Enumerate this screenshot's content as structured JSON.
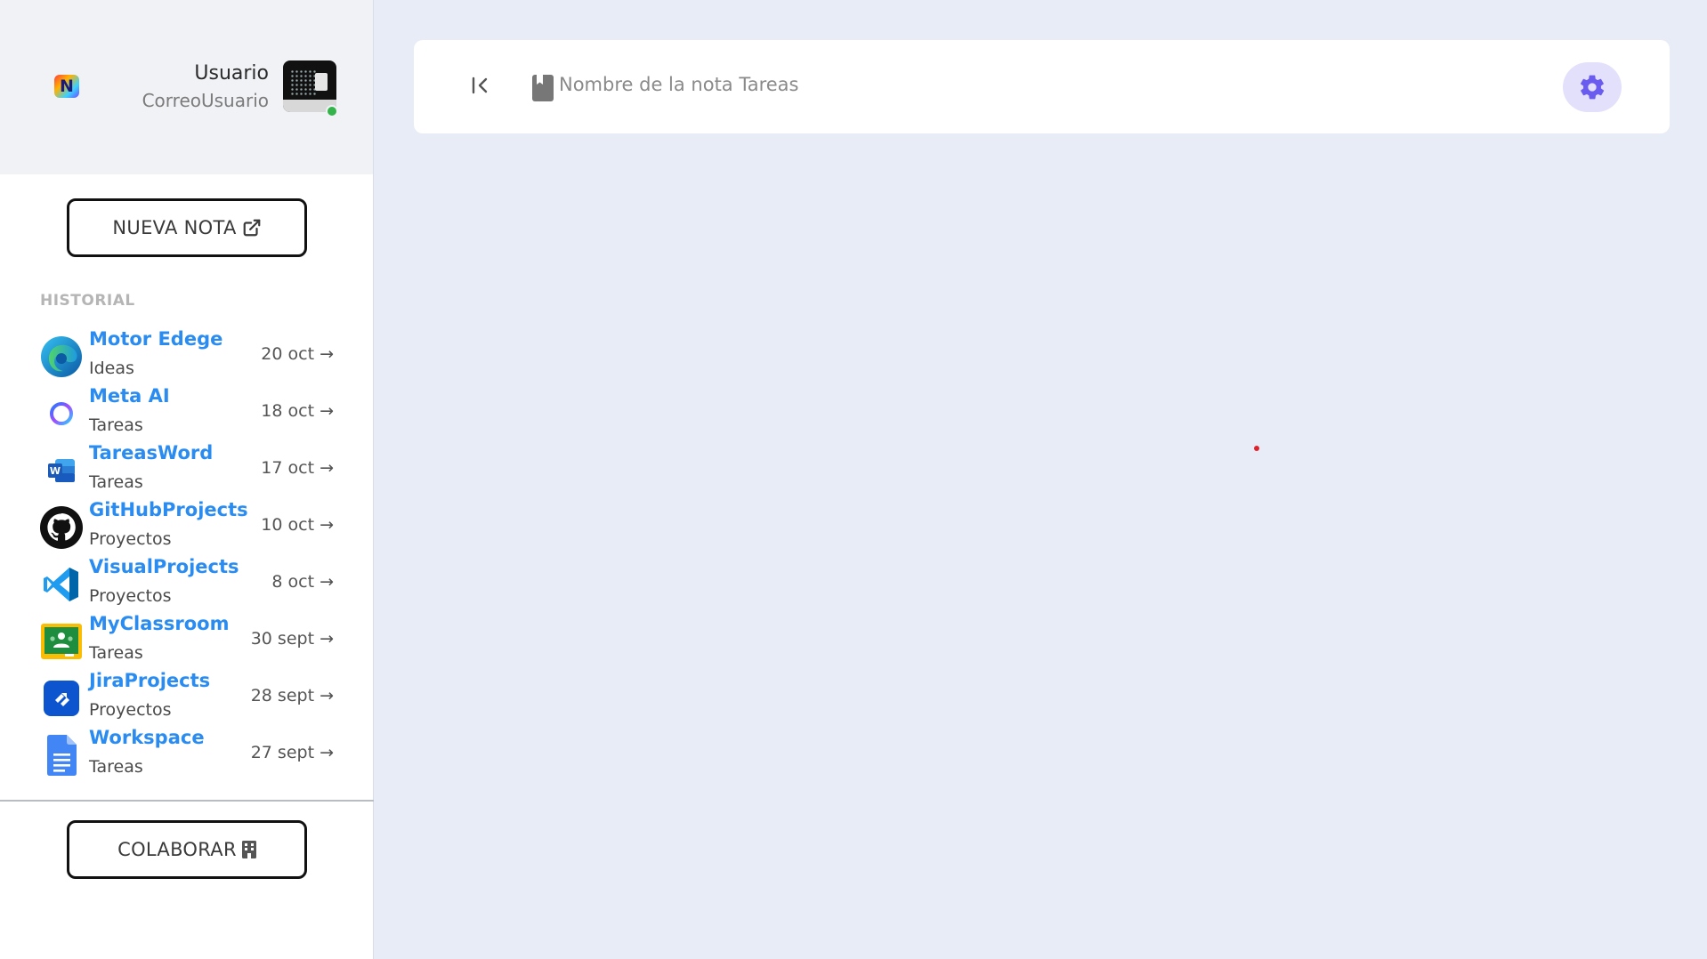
{
  "profile": {
    "app_logo_letter": "N",
    "user_name": "Usuario",
    "user_email": "CorreoUsuario",
    "status": "online"
  },
  "sidebar": {
    "new_note_label": "NUEVA NOTA",
    "history_label": "HISTORIAL",
    "collaborate_label": "COLABORAR",
    "history": [
      {
        "title": "Motor Edege",
        "category": "Ideas",
        "date": "20 oct →",
        "icon": "edge-icon"
      },
      {
        "title": "Meta AI",
        "category": "Tareas",
        "date": "18 oct →",
        "icon": "meta-ai-icon"
      },
      {
        "title": "TareasWord",
        "category": "Tareas",
        "date": "17 oct →",
        "icon": "word-icon"
      },
      {
        "title": "GitHubProjects",
        "category": "Proyectos",
        "date": "10 oct →",
        "icon": "github-icon"
      },
      {
        "title": "VisualProjects",
        "category": "Proyectos",
        "date": "8 oct →",
        "icon": "vscode-icon"
      },
      {
        "title": "MyClassroom",
        "category": "Tareas",
        "date": "30 sept →",
        "icon": "classroom-icon"
      },
      {
        "title": "JiraProjects",
        "category": "Proyectos",
        "date": "28 sept →",
        "icon": "jira-icon"
      },
      {
        "title": "Workspace",
        "category": "Tareas",
        "date": "27 sept →",
        "icon": "docs-icon"
      }
    ]
  },
  "header": {
    "note_name": "Nombre de la nota Tareas"
  },
  "colors": {
    "accent": "#2a8cf0",
    "background": "#e8ecf6",
    "settings_bg": "#e3e0fb",
    "settings_icon": "#6b5cf0"
  }
}
